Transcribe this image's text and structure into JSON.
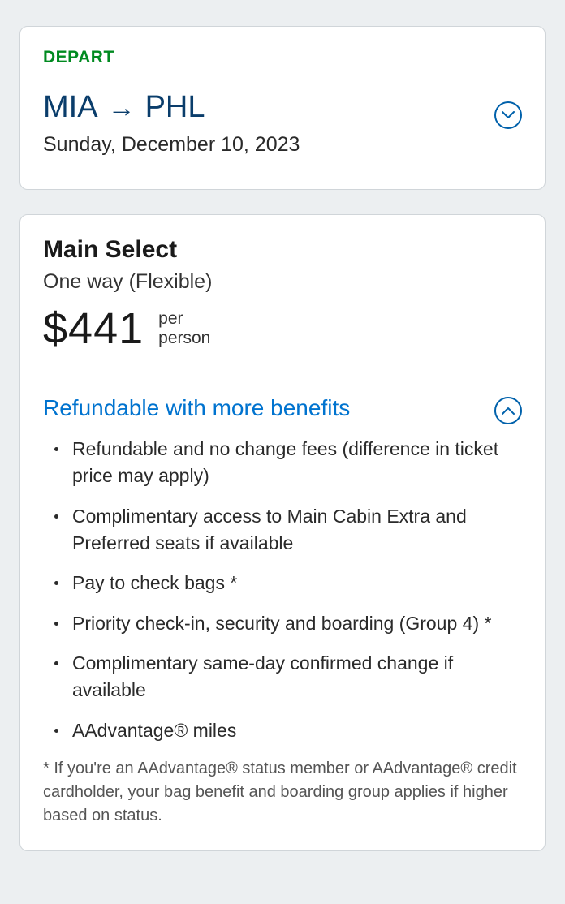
{
  "depart": {
    "label": "DEPART",
    "origin": "MIA",
    "destination": "PHL",
    "date": "Sunday, December 10, 2023"
  },
  "fare": {
    "name": "Main Select",
    "type": "One way (Flexible)",
    "price": "$441",
    "per_line1": "per",
    "per_line2": "person"
  },
  "benefits": {
    "title": "Refundable with more benefits",
    "items": [
      "Refundable and no change fees (difference in ticket price may apply)",
      "Complimentary access to Main Cabin Extra and Preferred seats if available",
      "Pay to check bags *",
      "Priority check-in, security and boarding (Group 4) *",
      "Complimentary same-day confirmed change if available",
      "AAdvantage® miles"
    ],
    "footnote": "* If you're an AAdvantage® status member or AAdvantage® credit cardholder, your bag benefit and boarding group applies if higher based on status."
  }
}
